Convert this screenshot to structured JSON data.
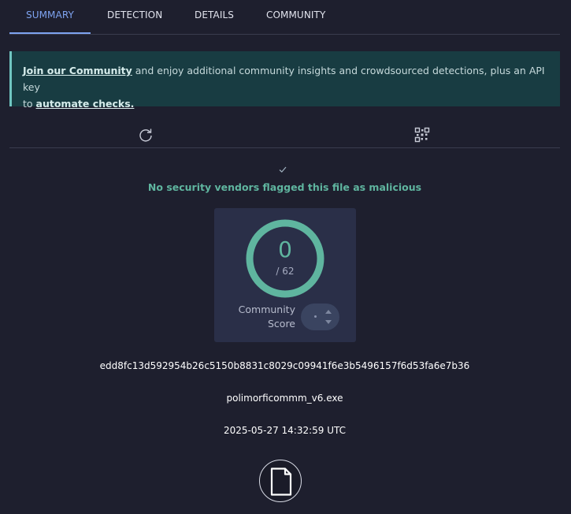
{
  "tabs": [
    {
      "label": "SUMMARY",
      "active": true
    },
    {
      "label": "DETECTION",
      "active": false
    },
    {
      "label": "DETAILS",
      "active": false
    },
    {
      "label": "COMMUNITY",
      "active": false
    }
  ],
  "banner": {
    "link1": "Join our Community",
    "text1": " and enjoy additional community insights and crowdsourced detections, plus an API key",
    "text2": "to ",
    "link2": "automate checks."
  },
  "toolbar": {
    "icons": [
      "refresh-icon",
      "qr-code-icon"
    ]
  },
  "verdict": {
    "icon": "check-icon",
    "text": "No security vendors flagged this file as malicious"
  },
  "score": {
    "value": "0",
    "total": "/ 62",
    "community_label_line1": "Community",
    "community_label_line2": "Score",
    "vote_dot": "•"
  },
  "file": {
    "hash": "edd8fc13d592954b26c5150b8831c8029c09941f6e3b5496157f6d53fa6e7b36",
    "name": "polimorficommm_v6.exe",
    "timestamp": "2025-05-27 14:32:59 UTC",
    "type_icon": "file-icon"
  },
  "colors": {
    "background": "#1e1f2e",
    "accent": "#7ea3f0",
    "clean_green": "#5fb59f",
    "banner_bg": "#183c42",
    "card_bg": "#2a2f48"
  }
}
